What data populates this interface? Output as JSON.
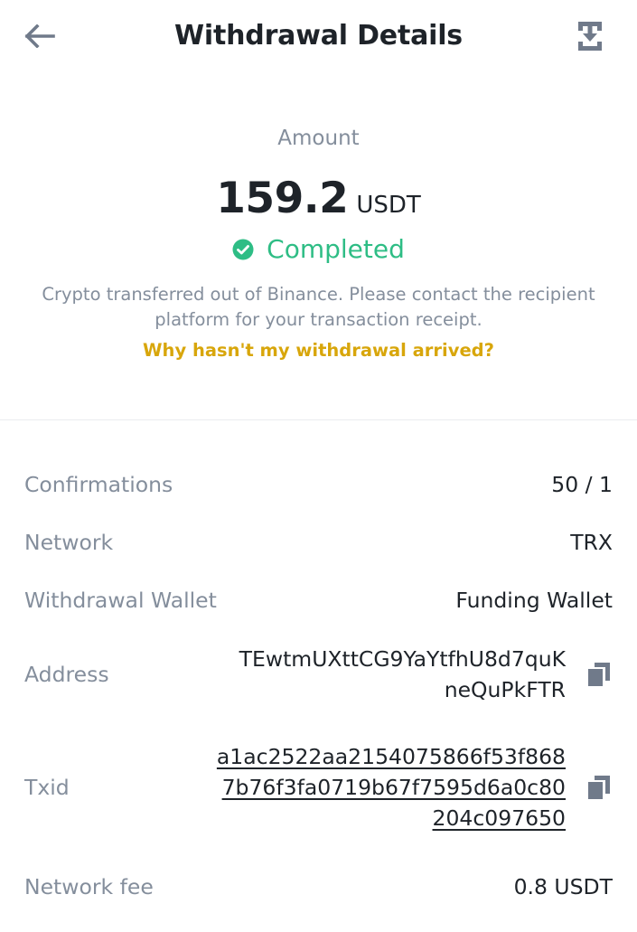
{
  "header": {
    "title": "Withdrawal Details",
    "back_icon": "arrow-left-icon",
    "download_icon": "download-icon"
  },
  "summary": {
    "amount_label": "Amount",
    "amount_value": "159.2",
    "amount_unit": "USDT",
    "status": "Completed",
    "status_icon": "check-circle-icon",
    "description": "Crypto transferred out of Binance. Please contact the recipient platform for your transaction receipt.",
    "help_link": "Why hasn't my withdrawal arrived?"
  },
  "details": {
    "confirmations": {
      "label": "Confirmations",
      "value": "50 / 1"
    },
    "network": {
      "label": "Network",
      "value": "TRX"
    },
    "wallet": {
      "label": "Withdrawal Wallet",
      "value": "Funding Wallet"
    },
    "address": {
      "label": "Address",
      "lines": [
        "TEwtmUXttCG9YaYtfhU8d7quK",
        "neQuPkFTR"
      ],
      "copy_icon": "copy-icon"
    },
    "txid": {
      "label": "Txid",
      "lines": [
        "a1ac2522aa2154075866f53f868",
        "7b76f3fa0719b67f7595d6a0c80",
        "204c097650"
      ],
      "copy_icon": "copy-icon"
    },
    "fee": {
      "label": "Network fee",
      "value": "0.8 USDT"
    }
  },
  "colors": {
    "text_primary": "#1e2329",
    "text_secondary": "#848e9c",
    "success": "#2ebd85",
    "link": "#d8a60b",
    "icon": "#707a8a"
  }
}
